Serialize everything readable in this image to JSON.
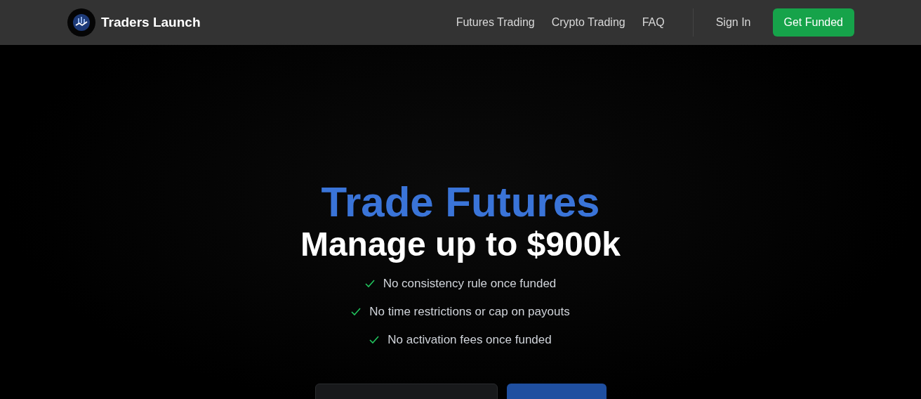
{
  "brand": {
    "name": "Traders Launch"
  },
  "nav": {
    "links": [
      "Futures Trading",
      "Crypto Trading",
      "FAQ"
    ],
    "sign_in": "Sign In",
    "cta": "Get Funded"
  },
  "hero": {
    "title": "Trade Futures",
    "subtitle": "Manage up to $900k",
    "features": [
      "No consistency rule once funded",
      "No time restrictions or cap on payouts",
      "No activation fees once funded"
    ],
    "buttons": [
      {
        "kind": "secondary"
      },
      {
        "kind": "primary"
      }
    ]
  }
}
